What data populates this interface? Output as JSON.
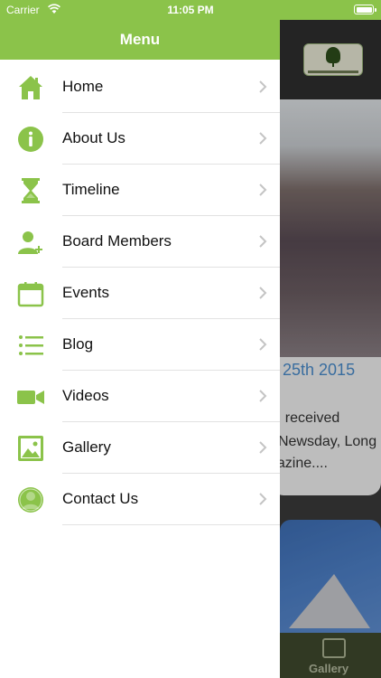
{
  "status_bar": {
    "carrier": "Carrier",
    "time": "11:05 PM"
  },
  "drawer": {
    "title": "Menu",
    "items": [
      {
        "label": "Home",
        "icon": "home-icon"
      },
      {
        "label": "About Us",
        "icon": "info-icon"
      },
      {
        "label": "Timeline",
        "icon": "hourglass-icon"
      },
      {
        "label": "Board Members",
        "icon": "add-person-icon"
      },
      {
        "label": "Events",
        "icon": "calendar-icon"
      },
      {
        "label": "Blog",
        "icon": "list-icon"
      },
      {
        "label": "Videos",
        "icon": "video-camera-icon"
      },
      {
        "label": "Gallery",
        "icon": "image-icon"
      },
      {
        "label": "Contact Us",
        "icon": "person-circle-icon"
      }
    ]
  },
  "background": {
    "article_date": "25th 2015",
    "article_lines": [
      "g, received",
      "Newsday, Long",
      "gazine...."
    ],
    "tab_label": "Gallery"
  },
  "colors": {
    "accent": "#8bc34a",
    "tabbar": "#3f4a2e",
    "link": "#4a8ccc"
  }
}
